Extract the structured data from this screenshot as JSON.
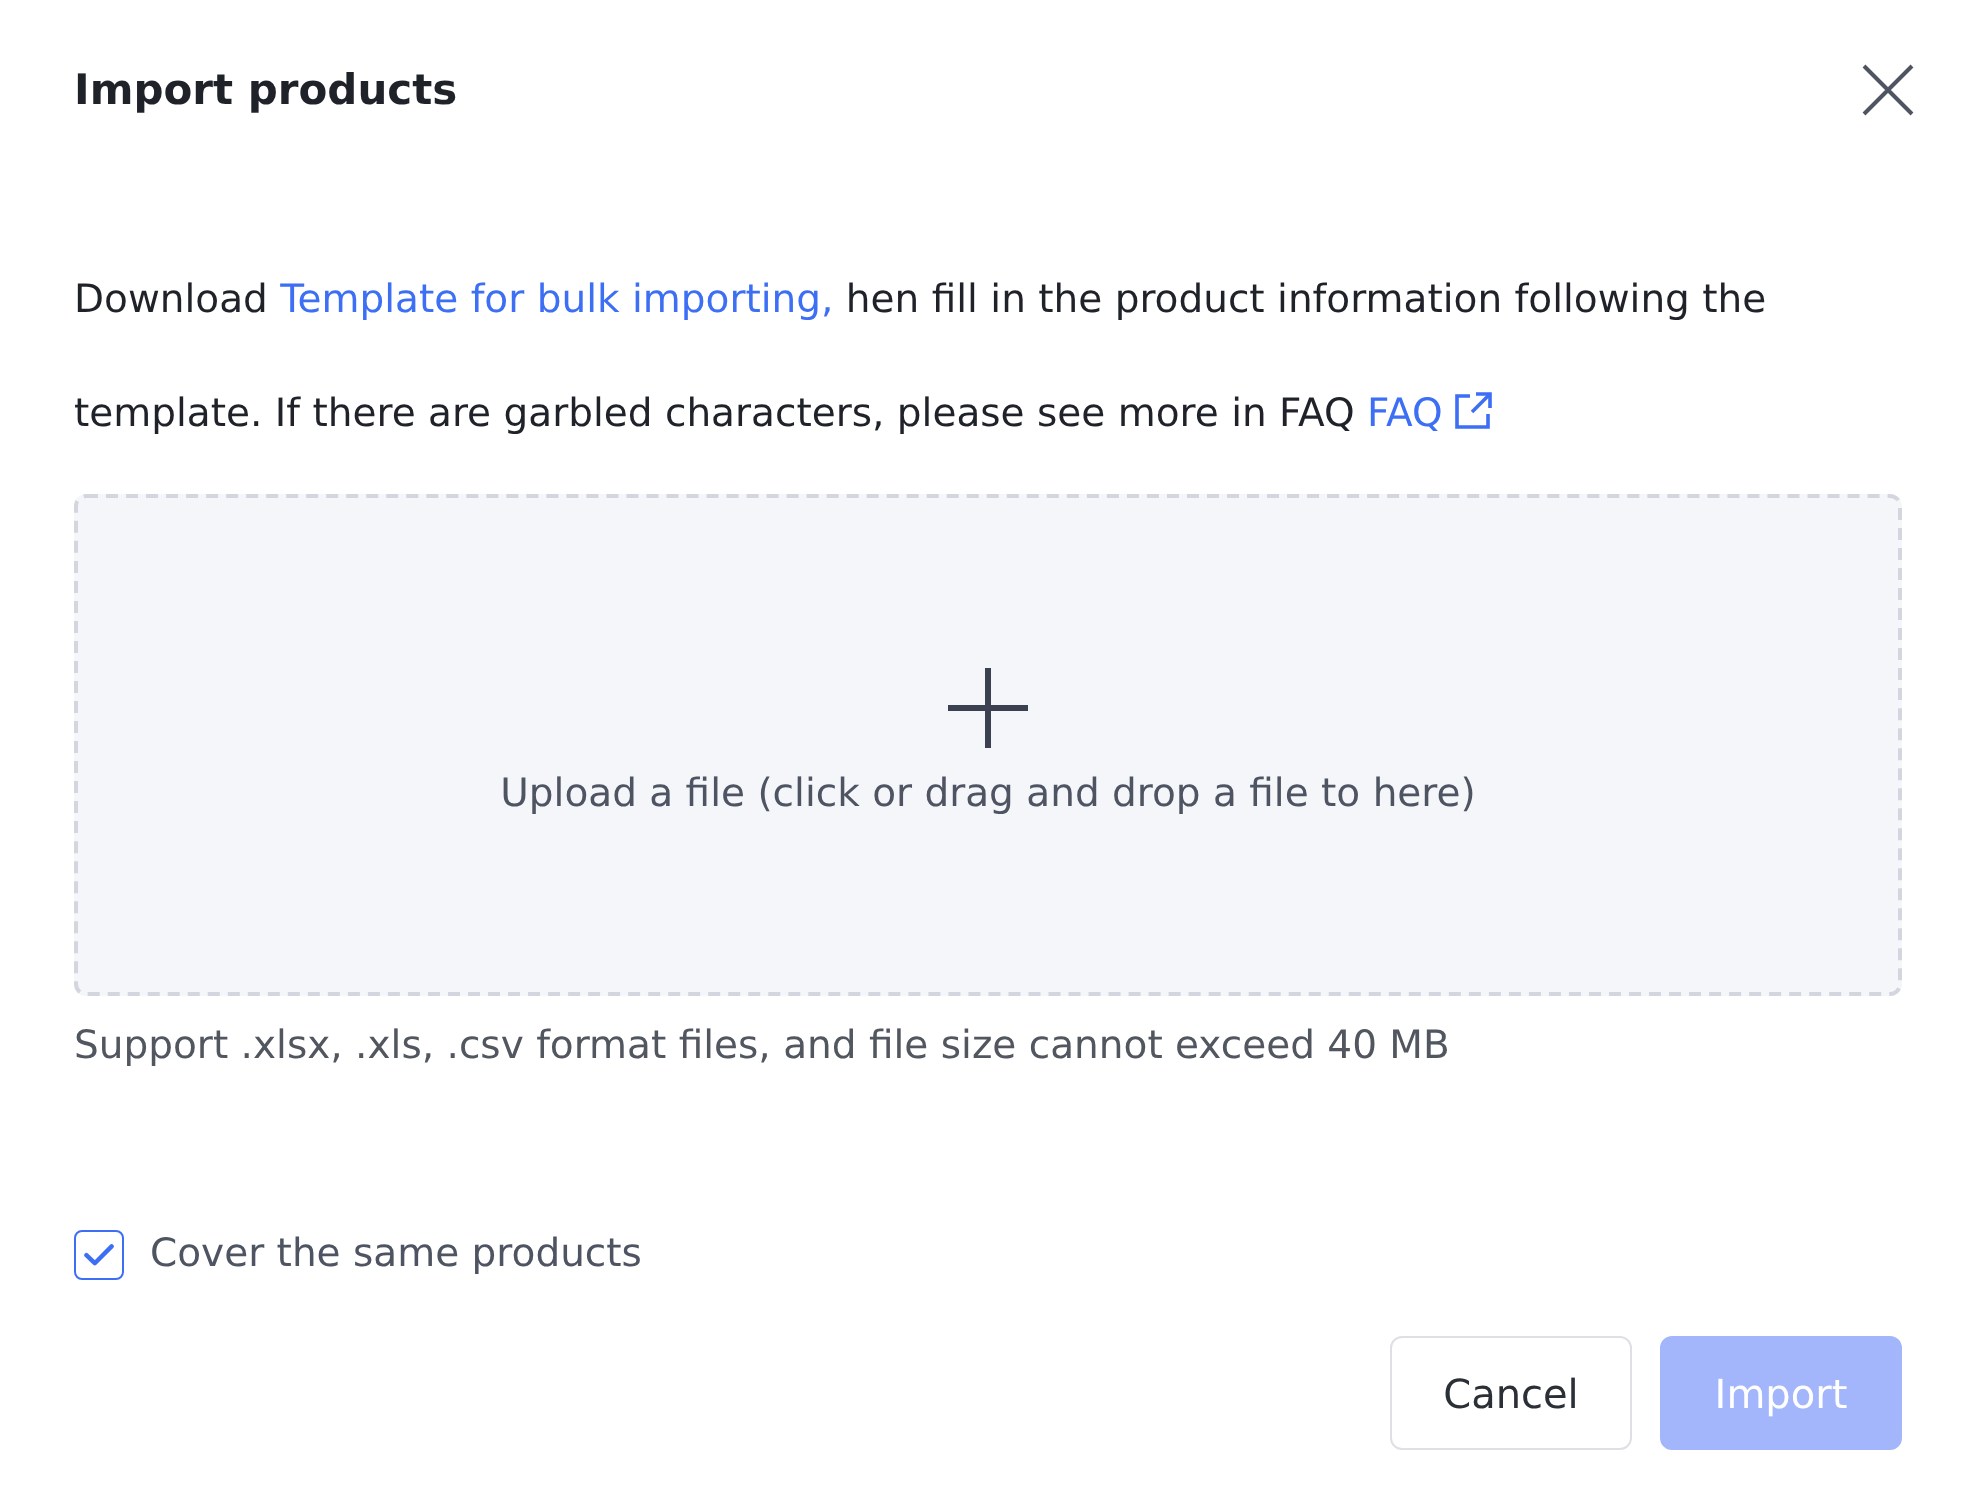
{
  "dialog": {
    "title": "Import products"
  },
  "instructions": {
    "parts": [
      {
        "kind": "text",
        "text": "Download"
      },
      {
        "kind": "link",
        "text": "Template for bulk importing,"
      },
      {
        "kind": "text",
        "text": "hen fill in the product information following the template. If there are garbled characters, please see more in FAQ"
      },
      {
        "kind": "external_link",
        "text": "FAQ"
      }
    ]
  },
  "upload": {
    "label": "Upload a file (click or drag and drop a file to here)"
  },
  "hint": "Support .xlsx, .xls, .csv format files, and file size cannot exceed 40 MB",
  "option": {
    "label": "Cover the same products",
    "checked": true
  },
  "buttons": [
    {
      "kind": "secondary",
      "label": "Cancel",
      "disabled": false
    },
    {
      "kind": "primary",
      "label": "Import",
      "disabled": true
    }
  ]
}
